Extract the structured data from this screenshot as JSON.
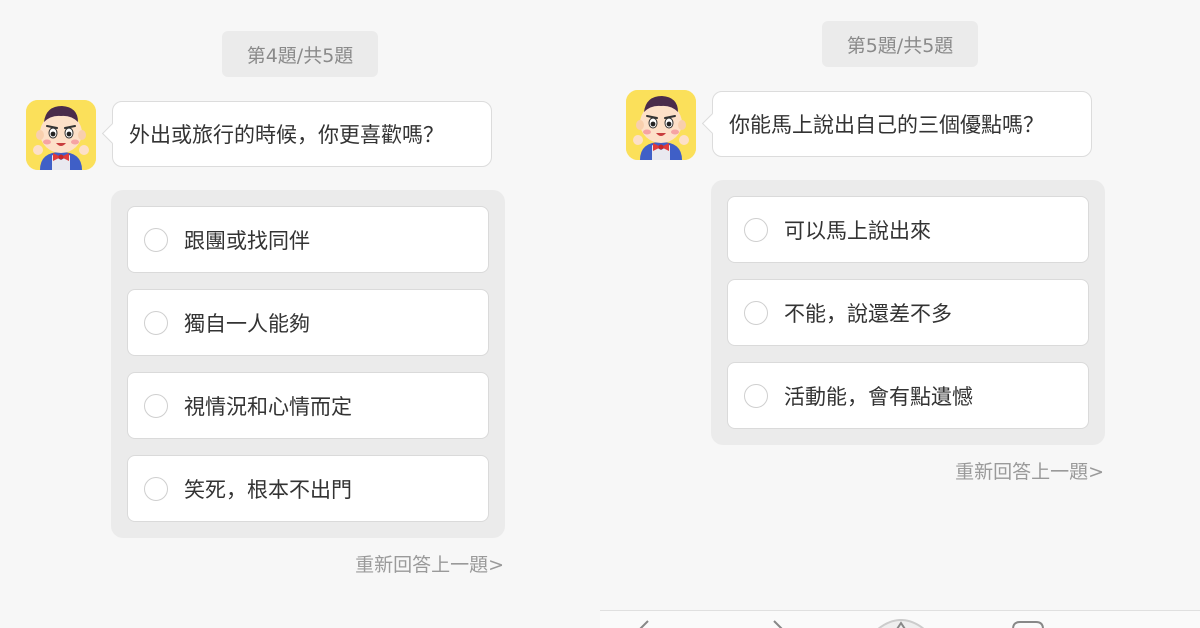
{
  "left": {
    "counter": "第4題/共5題",
    "question": "外出或旅行的時候，你更喜歡嗎？",
    "options": [
      "跟團或找同伴",
      "獨自一人能夠",
      "視情況和心情而定",
      "笑死，根本不出門"
    ],
    "redo": "重新回答上一題>"
  },
  "right": {
    "counter": "第5題/共5題",
    "question": "你能馬上說出自己的三個優點嗎？",
    "options": [
      "可以馬上說出來",
      "不能，說還差不多",
      "活動能，會有點遺憾"
    ],
    "redo": "重新回答上一題>"
  },
  "avatar_icon": "cartoon-boy-avatar",
  "colors": {
    "avatar_bg": "#fbe05a",
    "options_bg": "#ebebeb",
    "page_bg": "#f7f7f7",
    "muted_text": "#9a9a9a"
  }
}
